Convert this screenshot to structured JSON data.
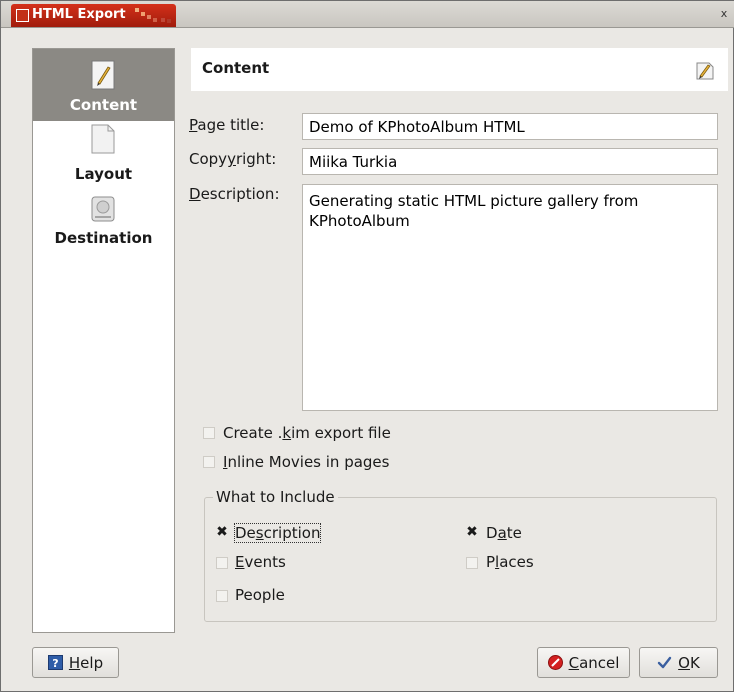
{
  "window": {
    "title": "HTML Export",
    "close_glyph": "x"
  },
  "sidebar": {
    "items": [
      {
        "label": "Content",
        "icon": "pencil-page-icon",
        "active": true
      },
      {
        "label": "Layout",
        "icon": "blank-page-icon",
        "active": false
      },
      {
        "label": "Destination",
        "icon": "hard-drive-icon",
        "active": false
      }
    ]
  },
  "header": {
    "title": "Content",
    "icon": "edit-icon"
  },
  "form": {
    "page_title": {
      "label_pre": "",
      "label_u": "P",
      "label_post": "age title:",
      "value": "Demo of KPhotoAlbum HTML"
    },
    "copyright": {
      "label_pre": "Copy",
      "label_u": "y",
      "label_post": "right:",
      "value": "Miika Turkia"
    },
    "description": {
      "label_pre": "",
      "label_u": "D",
      "label_post": "escription:",
      "value": "Generating static HTML picture gallery from KPhotoAlbum"
    },
    "create_kim": {
      "label_pre": "Create .",
      "label_u": "k",
      "label_post": "im export file",
      "checked": false
    },
    "inline_movies": {
      "label_pre": "",
      "label_u": "I",
      "label_post": "nline Movies in pages",
      "checked": false
    }
  },
  "include": {
    "title": "What to Include",
    "description": {
      "label_pre": "De",
      "label_u": "s",
      "label_post": "cription",
      "checked": true
    },
    "date": {
      "label_pre": "D",
      "label_u": "a",
      "label_post": "te",
      "checked": true
    },
    "events": {
      "label_pre": "",
      "label_u": "E",
      "label_post": "vents",
      "checked": false
    },
    "places": {
      "label_pre": "P",
      "label_u": "l",
      "label_post": "aces",
      "checked": false
    },
    "people": {
      "label_pre": "People",
      "label_u": "",
      "label_post": "",
      "checked": false
    }
  },
  "buttons": {
    "help": {
      "label_u": "H",
      "label_post": "elp"
    },
    "cancel": {
      "label_u": "C",
      "label_post": "ancel"
    },
    "ok": {
      "label_u": "O",
      "label_post": "K"
    }
  },
  "check_glyph": "✖",
  "colors": {
    "title_accent": "#c0301a",
    "sidebar_active": "#8b8984"
  }
}
